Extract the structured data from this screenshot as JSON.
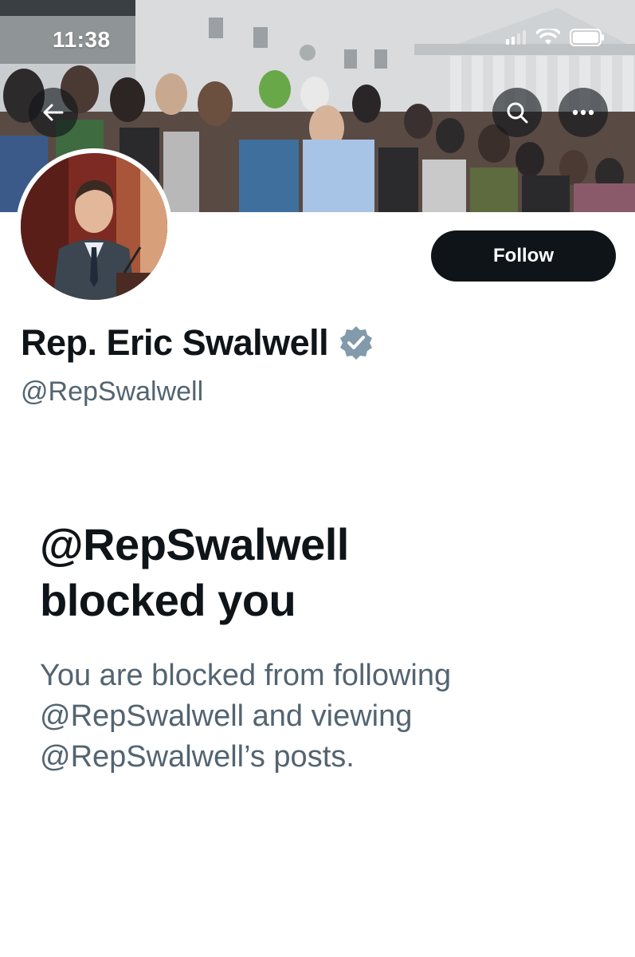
{
  "status_bar": {
    "time": "11:38"
  },
  "header": {
    "back_icon": "arrow-left-icon",
    "search_icon": "search-icon",
    "more_icon": "more-horizontal-icon"
  },
  "profile": {
    "follow_label": "Follow",
    "display_name": "Rep. Eric Swalwell",
    "verified_icon": "verified-badge-icon",
    "handle": "@RepSwalwell"
  },
  "blocked": {
    "title_line1": "@RepSwalwell",
    "title_line2": "blocked you",
    "description_line1": "You are blocked from following",
    "description_line2": "@RepSwalwell and viewing",
    "description_line3": "@RepSwalwell’s posts."
  },
  "colors": {
    "primary_text": "#0f1419",
    "secondary_text": "#536471",
    "follow_button_bg": "#0f1419",
    "verified_badge": "#829aab"
  }
}
